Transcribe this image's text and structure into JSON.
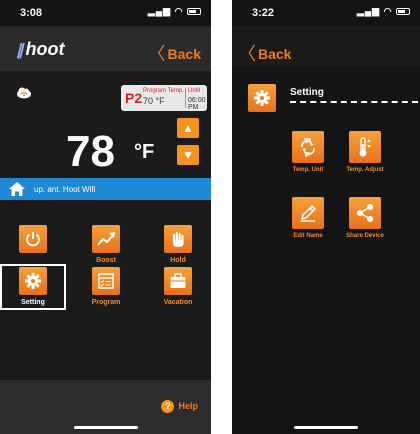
{
  "left": {
    "status": {
      "time": "3:08"
    },
    "nav": {
      "logo": "hoot",
      "back_label": "Back"
    },
    "program": {
      "code": "P2",
      "label": "Program Temp.",
      "value": "70 °F",
      "until_label": "Until",
      "until_value": "06:00 PM"
    },
    "temperature": {
      "value": "78",
      "unit": "°F"
    },
    "wifi": {
      "name": "up. ant. Hoot Wifi"
    },
    "tiles": [
      {
        "label": "",
        "icon": "power-icon"
      },
      {
        "label": "Boost",
        "icon": "trend-up-icon"
      },
      {
        "label": "Hold",
        "icon": "hand-icon"
      },
      {
        "label": "Setting",
        "icon": "gear-icon"
      },
      {
        "label": "Program",
        "icon": "schedule-icon"
      },
      {
        "label": "Vacation",
        "icon": "suitcase-icon"
      }
    ],
    "help_label": "Help"
  },
  "right": {
    "status": {
      "time": "3:22"
    },
    "nav": {
      "back_label": "Back"
    },
    "section_title": "Setting",
    "tiles": [
      {
        "label": "Temp. Unit",
        "icon": "temp-unit-icon"
      },
      {
        "label": "Temp. Adjust",
        "icon": "thermometer-icon"
      },
      {
        "label": "Edit Name",
        "icon": "pencil-icon"
      },
      {
        "label": "Share Device",
        "icon": "share-icon"
      }
    ]
  },
  "colors": {
    "accent": "#f7941d",
    "wifi_bar": "#1e8ad6",
    "background": "#141414"
  }
}
